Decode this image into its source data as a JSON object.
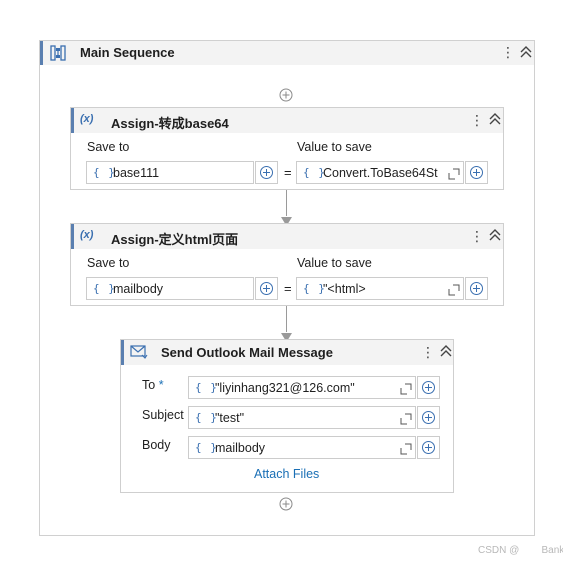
{
  "main": {
    "title": "Main Sequence"
  },
  "assign1": {
    "title": "Assign-转成base64",
    "save_to_label": "Save to",
    "value_label": "Value to save",
    "save_to_value": "base111",
    "value": "Convert.ToBase64St",
    "eq": "="
  },
  "assign2": {
    "title": "Assign-定义html页面",
    "save_to_label": "Save to",
    "value_label": "Value to save",
    "save_to_value": "mailbody",
    "value": "\"<html>",
    "eq": "="
  },
  "send": {
    "title": "Send Outlook Mail Message",
    "to_label": "To",
    "required_mark": "*",
    "to_value": "\"liyinhang321@126.com\"",
    "subject_label": "Subject",
    "subject_value": "\"test\"",
    "body_label": "Body",
    "body_value": "mailbody",
    "attach_label": "Attach Files"
  },
  "expr_braces": "{ }",
  "watermark": "CSDN @        Bank",
  "colors": {
    "accent": "#3a6fb0",
    "header_bg": "#f3f3f3",
    "link": "#1a6fb5"
  }
}
